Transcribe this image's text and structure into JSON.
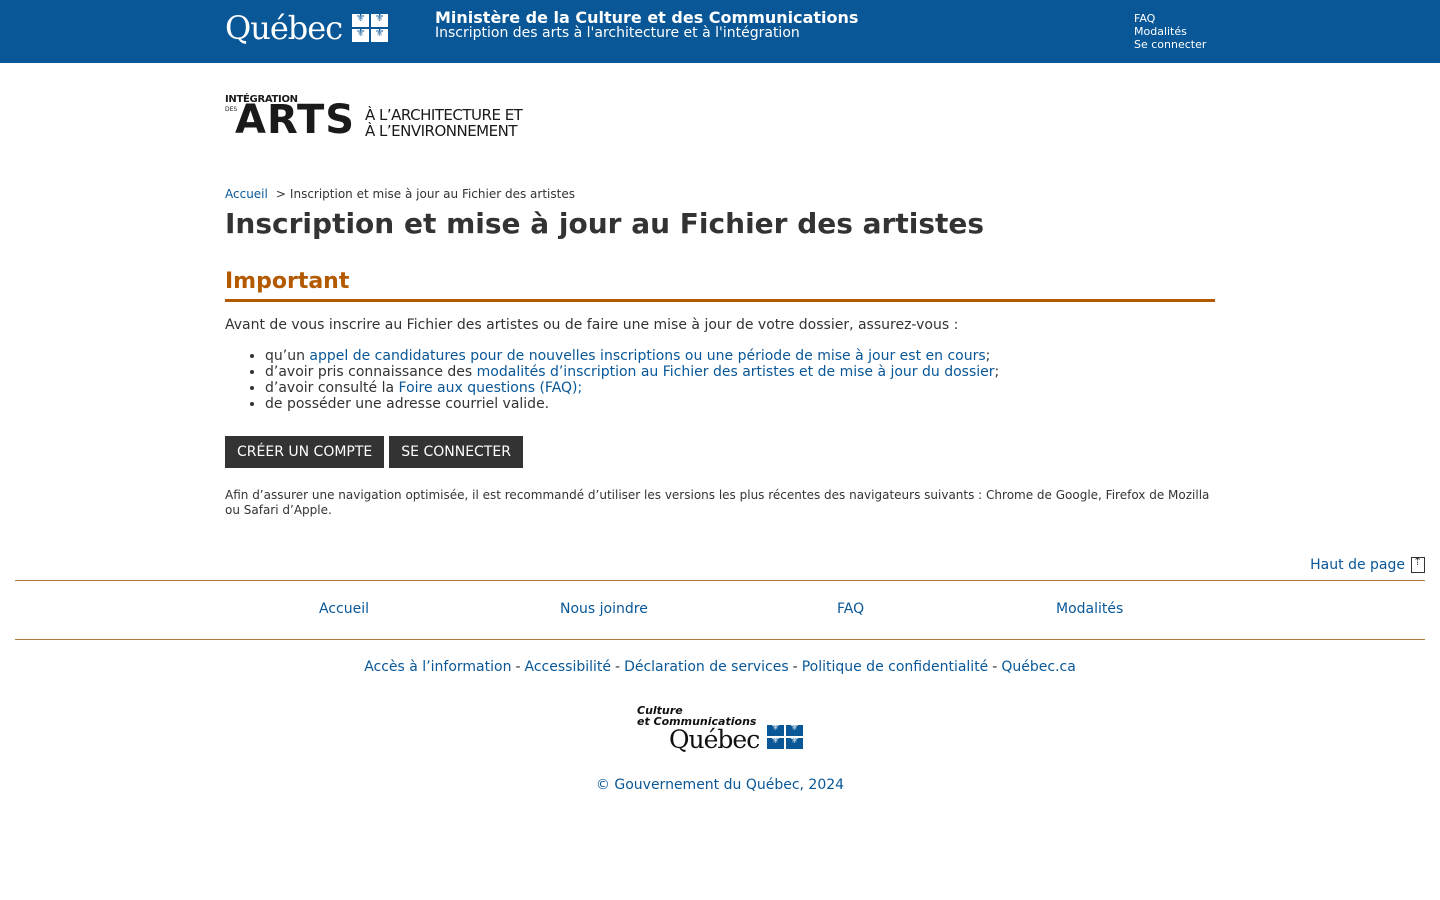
{
  "header": {
    "logo_text": "Québec",
    "ministry": "Ministère de la Culture et des Communications",
    "subtitle": "Inscription des arts à l'architecture et à l'intégration",
    "links": [
      "FAQ",
      "Modalités",
      "Se connecter"
    ]
  },
  "program_logo": {
    "line_integration": "INTÉGRATION",
    "line_des": "DES",
    "line_arts": "ARTS",
    "line_architecture": "À L’ARCHITECTURE ET",
    "line_environnement": "À L’ENVIRONNEMENT"
  },
  "breadcrumb": {
    "home": "Accueil",
    "separator": ">",
    "current": "Inscription et mise à jour au Fichier des artistes"
  },
  "page_title": "Inscription et mise à jour au Fichier des artistes",
  "important": {
    "title": "Important",
    "intro": "Avant de vous inscrire au Fichier des artistes ou de faire une mise à jour de votre dossier, assurez-vous :",
    "items": [
      {
        "before": "qu’un ",
        "link": "appel de candidatures pour de nouvelles inscriptions ou une période de mise à jour est en cours",
        "after": ";"
      },
      {
        "before": "d’avoir pris connaissance des ",
        "link": "modalités d’inscription au Fichier des artistes et de mise à jour du dossier",
        "after": ";"
      },
      {
        "before": "d’avoir consulté la ",
        "link": "Foire aux questions (FAQ);",
        "after": ""
      },
      {
        "before": "de posséder une adresse courriel valide.",
        "link": "",
        "after": ""
      }
    ]
  },
  "buttons": {
    "create_account": "CRÉER UN COMPTE",
    "login": "SE CONNECTER"
  },
  "browser_notice": "Afin d’assurer une navigation optimisée, il est recommandé d’utiliser les versions les plus récentes des navigateurs suivants : Chrome de Google, Firefox de Mozilla ou Safari d’Apple.",
  "footer": {
    "top_of_page": "Haut de page",
    "nav": [
      "Accueil",
      "Nous joindre",
      "FAQ",
      "Modalités"
    ],
    "links": [
      "Accès à l’information",
      "Accessibilité",
      "Déclaration de services",
      "Politique de confidentialité",
      "Québec.ca"
    ],
    "link_separator": "-",
    "logo_line1": "Culture",
    "logo_line2": "et Communications",
    "logo_word": "Québec",
    "copyright": "© Gouvernement du Québec, 2024"
  },
  "colors": {
    "banner": "#095797",
    "accent": "#b35900",
    "link": "#095797",
    "button": "#333333"
  }
}
